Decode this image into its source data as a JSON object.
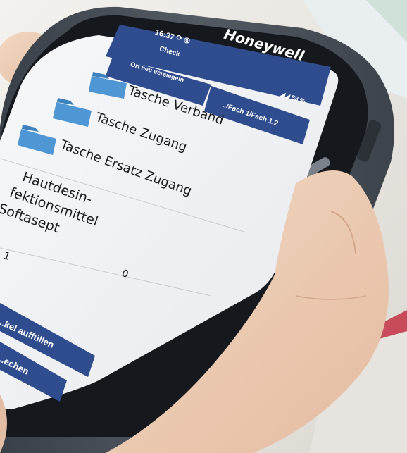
{
  "device": {
    "brand": "Honeywell"
  },
  "status_bar": {
    "time": "16:37",
    "status_icons": "⟳ ◎",
    "battery": "◢◢ 58 %"
  },
  "app": {
    "title": "Check",
    "reseal_button_label": "Ort neu versiegeln",
    "location_button_label": "../Fach 1/Fach 1.2"
  },
  "folders": [
    {
      "label": "Tasche Verband"
    },
    {
      "label": "Tasche Zugang"
    },
    {
      "label": "Tasche Ersatz Zugang"
    }
  ],
  "item": {
    "name_line1": "Hautdesin-",
    "name_line2": "fektionsmittel",
    "name_line3": "Softasept",
    "count_left": "1",
    "count_right": "0"
  },
  "bottom_buttons": {
    "refill_label": "...kel auffüllen",
    "cancel_label": "...echen"
  },
  "colors": {
    "primary_blue": "#2f4c8f",
    "folder_blue": "#4f97d4",
    "device_gray": "#4a5159"
  }
}
